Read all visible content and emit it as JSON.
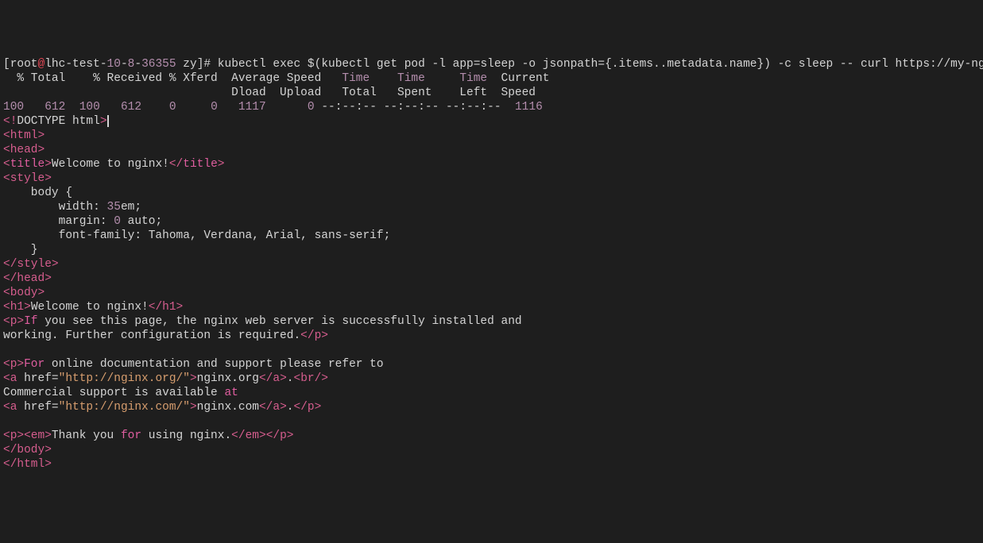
{
  "prompt": {
    "open_bracket": "[",
    "user": "root",
    "at": "@",
    "host1": "lhc-test-",
    "host2": "10",
    "dash1": "-",
    "host3": "8",
    "dash2": "-",
    "host4": "36355",
    "space_dir": " zy",
    "close_bracket": "]",
    "hash": "#"
  },
  "command": " kubectl exec $(kubectl get pod -l app=sleep -o jsonpath={.items..metadata.name}) -c sleep -- curl https://my-nginx -k",
  "curl_header1": "  % Total    % Received % Xferd  Average Speed   ",
  "curl_time1": "Time",
  "curl_sp1": "    ",
  "curl_time2": "Time",
  "curl_sp2": "     ",
  "curl_time3": "Time",
  "curl_sp3": "  Current",
  "curl_header2": "                                 Dload  Upload   Total   Spent    Left  Speed",
  "stats": {
    "s1": "100",
    "s2": "   612",
    "s3": "  100",
    "s4": "   612",
    "s5": "    0",
    "s6": "     0",
    "s7": "   1117",
    "s8": "      0",
    "s9": " --:--:-- --:--:-- --:--:--  ",
    "s10": "1116"
  },
  "doctype": {
    "lt": "<",
    "excl": "!",
    "text": "DOCTYPE html",
    "gt": ">"
  },
  "tags": {
    "html_open": "<html>",
    "head_open": "<head>",
    "title_open_lt": "<",
    "title_open_name": "title",
    "title_open_gt": ">",
    "title_text": "Welcome to nginx!",
    "title_close_lt": "</",
    "title_close_name": "title",
    "title_close_gt": ">",
    "style_open": "<style>",
    "style_close": "</style>",
    "head_close": "</head>",
    "body_open": "<body>",
    "h1_open": "<h1>",
    "h1_text": "Welcome to nginx!",
    "h1_close": "</h1>",
    "p_open": "<p>",
    "p_close": "</p>",
    "a_open1": "<a",
    "href_attr": " href=",
    "href_val1": "\"http://nginx.org/\"",
    "a_gt": ">",
    "a_text1": "nginx.org",
    "a_close": "</a>",
    "dot": ".",
    "br": "<br/>",
    "href_val2": "\"http://nginx.com/\"",
    "a_text2": "nginx.com",
    "em_open": "<em>",
    "em_close": "</em>",
    "body_close": "</body>",
    "html_close": "</html>"
  },
  "p1_if": "If",
  "p1_text": " you see this page, the nginx web server is successfully installed and",
  "p1_text2": "working. Further configuration is required.",
  "p2_for": "For",
  "p2_text": " online documentation and support please refer to",
  "commercial": "Commercial support is available ",
  "at_kw": "at",
  "thank_pre": "Thank you ",
  "for_kw": "for",
  "thank_post": " using nginx.",
  "css": {
    "l1": "    body {",
    "l2a": "        width: ",
    "l2b": "35",
    "l2c": "em;",
    "l3a": "        margin: ",
    "l3b": "0",
    "l3c": " auto;",
    "l4": "        font-family: Tahoma, Verdana, Arial, sans-serif;",
    "l5": "    }"
  }
}
